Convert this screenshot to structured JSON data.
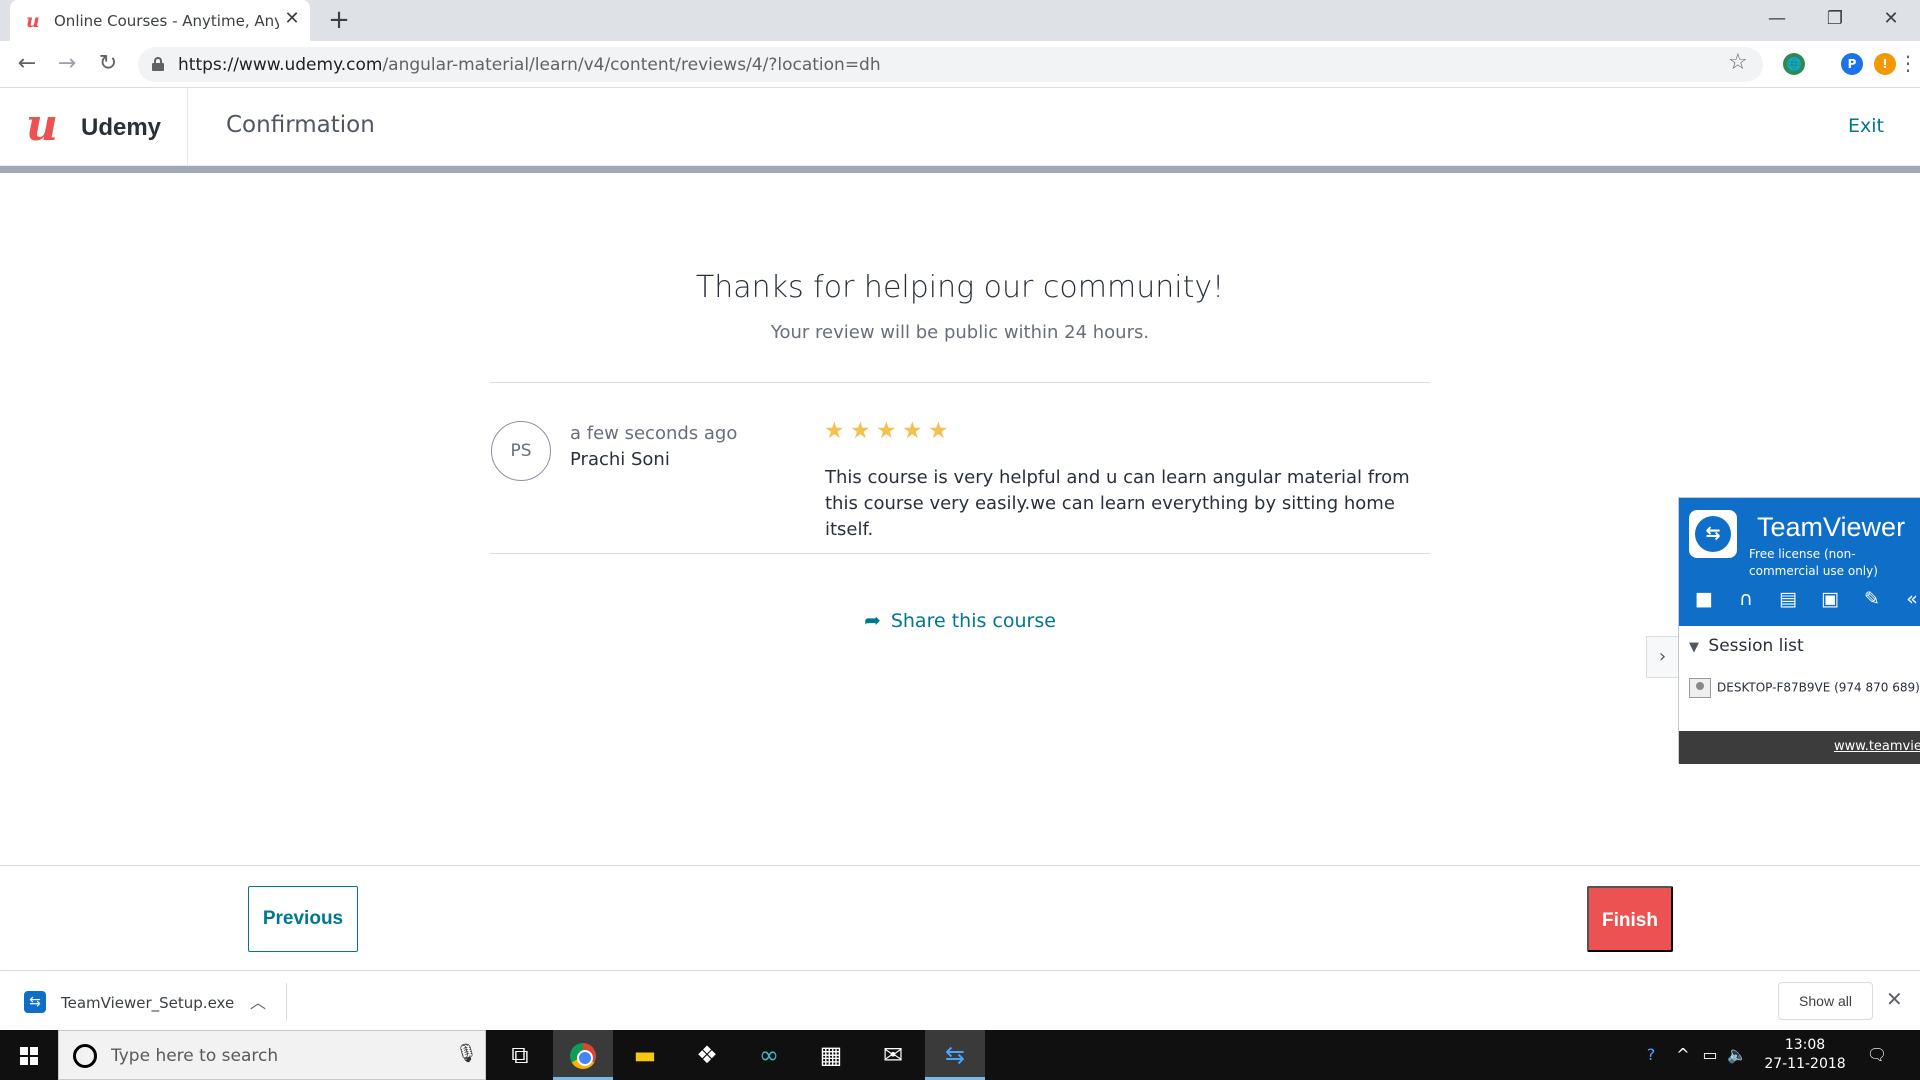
{
  "browser": {
    "tab_title": "Online Courses - Anytime, Anywhere",
    "url_host": "https://www.udemy.com",
    "url_path": "/angular-material/learn/v4/content/reviews/4/?location=dh",
    "profile_initial": "P",
    "alert_glyph": "!"
  },
  "header": {
    "logo_text": "Udemy",
    "page_title": "Confirmation",
    "exit_label": "Exit"
  },
  "main": {
    "thanks_title": "Thanks for helping our community!",
    "thanks_subtitle": "Your review will be public within 24 hours.",
    "review": {
      "initials": "PS",
      "time": "a few seconds ago",
      "author": "Prachi Soni",
      "rating": 5,
      "text": "This course is very helpful and u can learn angular material from this course very easily.we can learn everything by sitting home itself."
    },
    "share_label": "Share this course"
  },
  "footer": {
    "previous_label": "Previous",
    "finish_label": "Finish"
  },
  "teamviewer": {
    "title": "TeamViewer",
    "license": "Free license (non-commercial use only)",
    "session_list_label": "Session list",
    "device": "DESKTOP-F87B9VE (974 870 689)",
    "link": "www.teamviewer.com"
  },
  "downloads": {
    "file_name": "TeamViewer_Setup.exe",
    "show_all_label": "Show all"
  },
  "taskbar": {
    "search_placeholder": "Type here to search",
    "time": "13:08",
    "date": "27-11-2018"
  },
  "colors": {
    "udemy_red": "#ec5252",
    "udemy_teal": "#007791",
    "star_gold": "#f4c150",
    "teamviewer_blue": "#0e6ec8"
  }
}
